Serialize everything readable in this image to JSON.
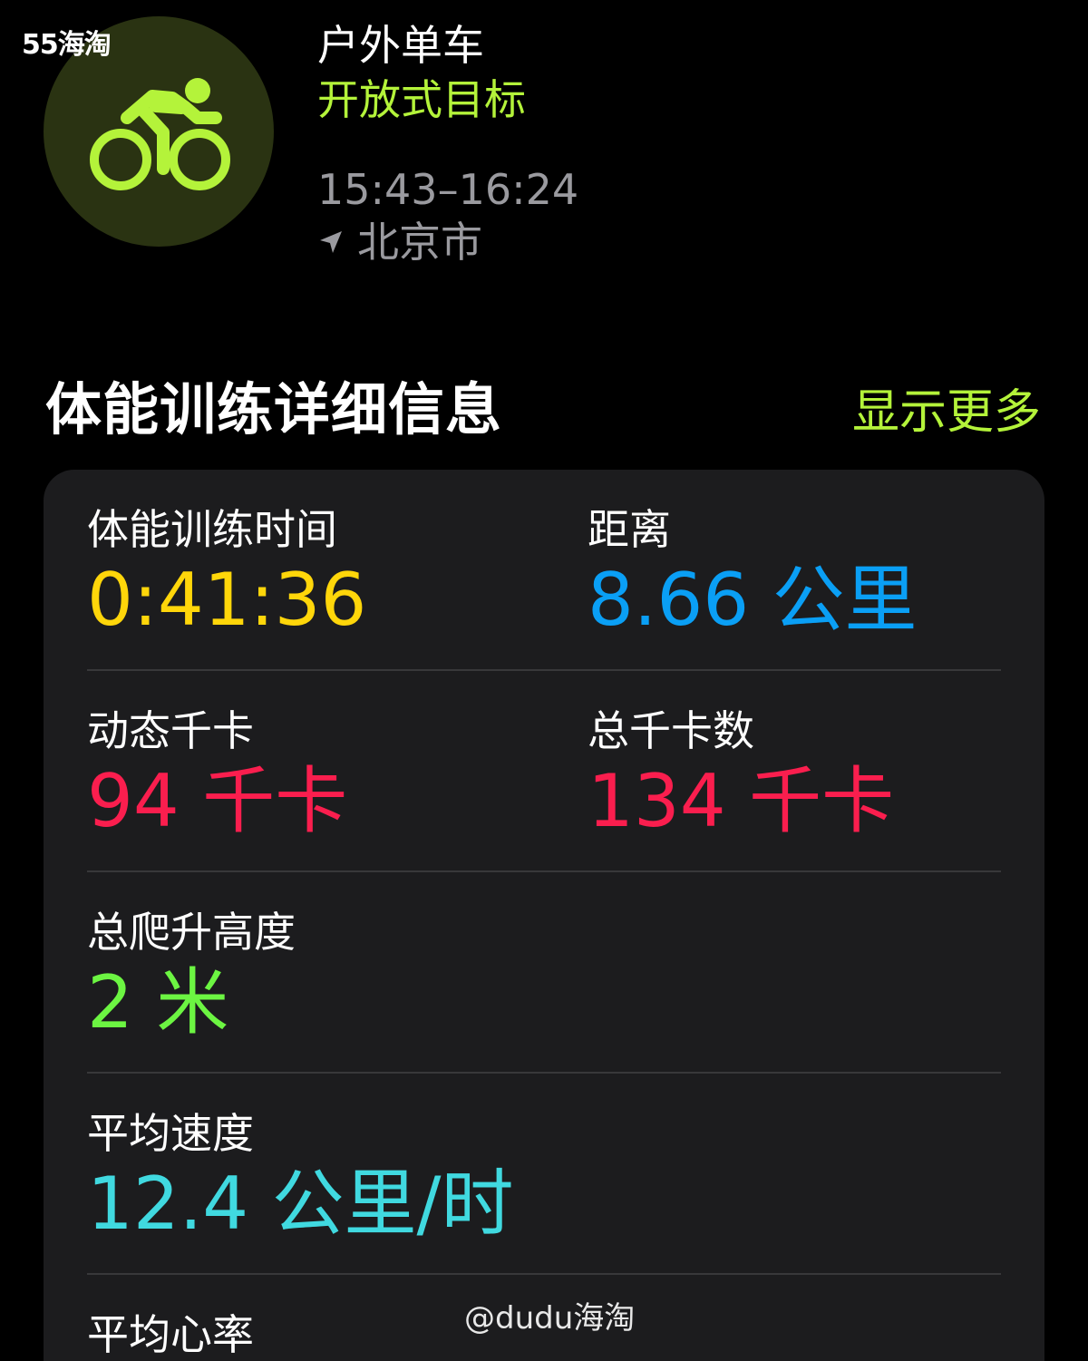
{
  "watermark": {
    "top_left": "55海淘",
    "bottom": "@dudu海淘"
  },
  "header": {
    "workout_type": "户外单车",
    "goal": "开放式目标",
    "time_range": "15:43–16:24",
    "location": "北京市",
    "icon": "cycling-icon",
    "location_icon": "location-arrow-icon"
  },
  "section": {
    "title": "体能训练详细信息",
    "show_more": "显示更多"
  },
  "metrics": {
    "duration": {
      "label": "体能训练时间",
      "value": "0:41:36",
      "color": "#ffd60a"
    },
    "distance": {
      "label": "距离",
      "value": "8.66",
      "unit": "公里",
      "color": "#0a9ff5"
    },
    "active_kcal": {
      "label": "动态千卡",
      "value": "94",
      "unit": "千卡",
      "color": "#fa1e4e"
    },
    "total_kcal": {
      "label": "总千卡数",
      "value": "134",
      "unit": "千卡",
      "color": "#fa1e4e"
    },
    "elevation": {
      "label": "总爬升高度",
      "value": "2",
      "unit": "米",
      "color": "#6cf542"
    },
    "avg_speed": {
      "label": "平均速度",
      "value": "12.4",
      "unit": "公里/时",
      "color": "#40d9e0"
    },
    "avg_hr": {
      "label": "平均心率"
    }
  },
  "colors": {
    "accent_green": "#b4f33a",
    "card_bg": "#1c1c1e",
    "secondary_text": "#9a9a9f"
  }
}
